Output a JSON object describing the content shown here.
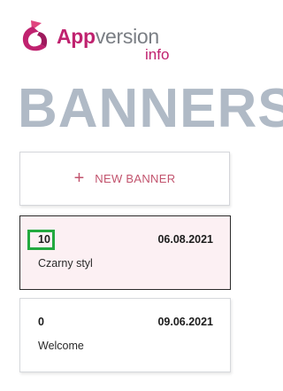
{
  "logo": {
    "brand_app": "App",
    "brand_version": "version",
    "brand_sub": "info",
    "icon": "appversion-logo-icon"
  },
  "page": {
    "title": "BANNERS"
  },
  "new_banner": {
    "icon": "plus-icon",
    "icon_glyph": "+",
    "label": "NEW BANNER"
  },
  "banners": [
    {
      "count": "10",
      "date": "06.08.2021",
      "name": "Czarny styl",
      "selected": true
    },
    {
      "count": "0",
      "date": "09.06.2021",
      "name": "Welcome",
      "selected": false
    }
  ],
  "colors": {
    "brand": "#c0226f",
    "title": "#b0bac6",
    "accent": "#c2546e",
    "selected_bg": "#fcf0f3",
    "highlight": "#23a93f"
  }
}
